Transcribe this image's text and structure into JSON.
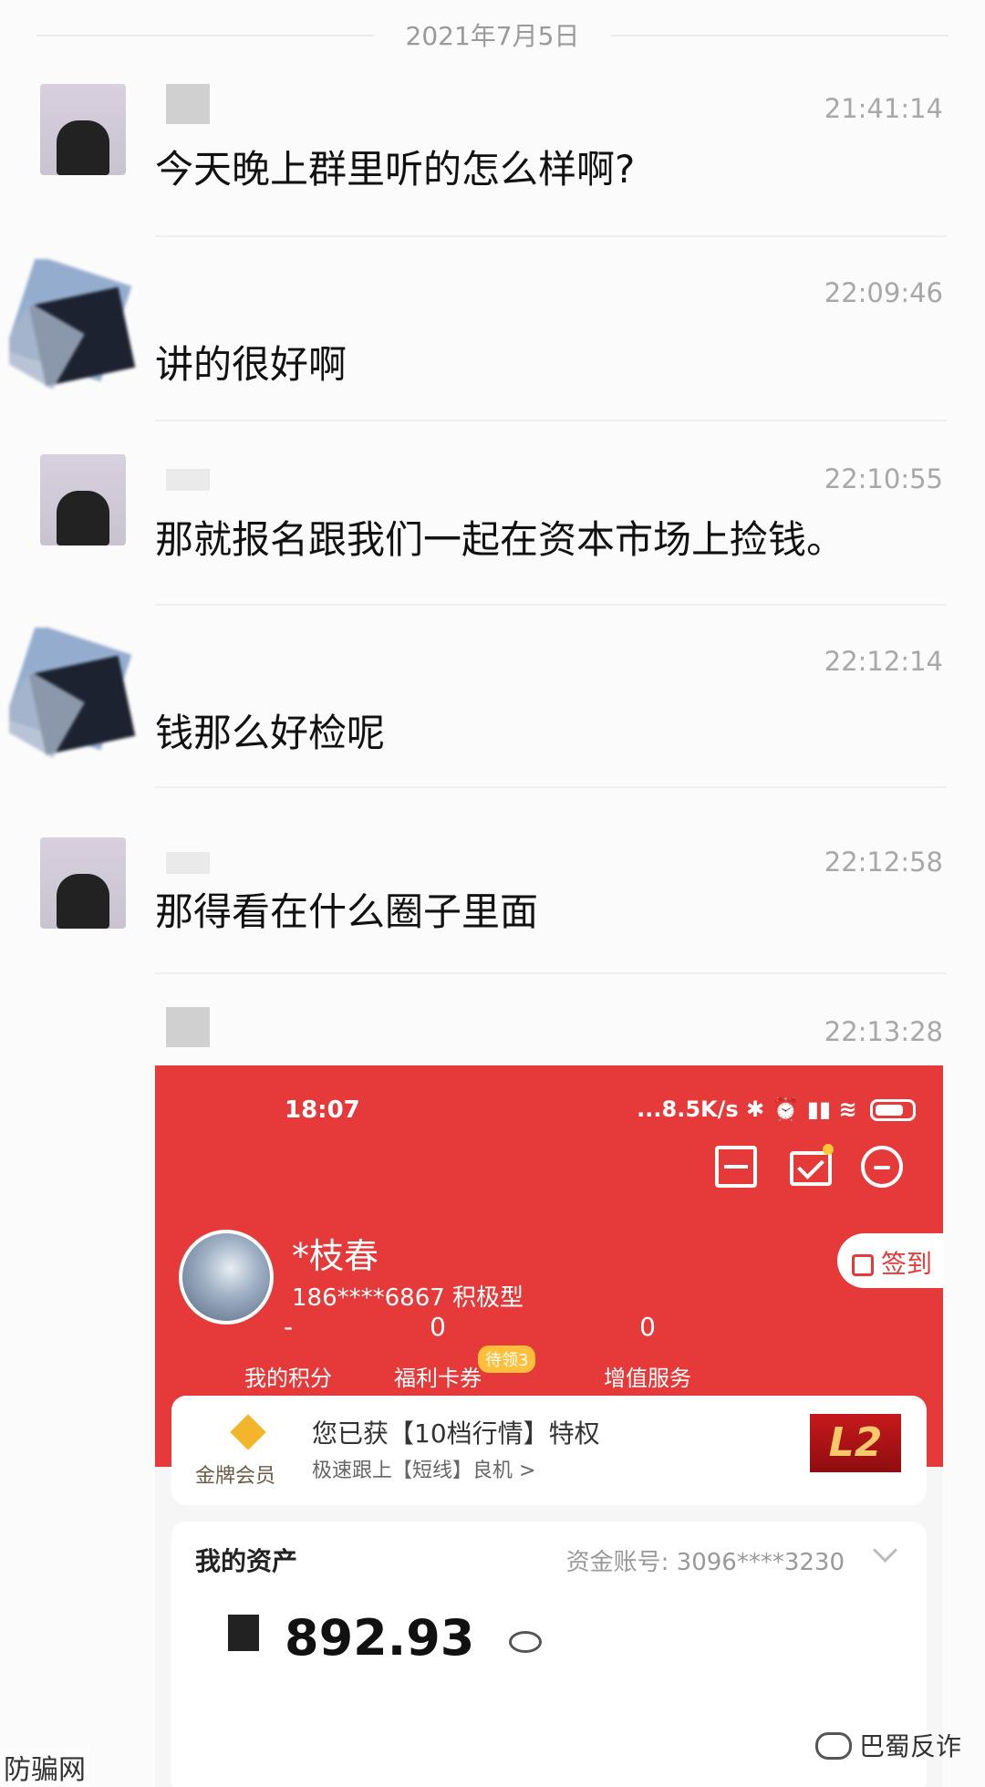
{
  "date_separator": "2021年7月5日",
  "messages": [
    {
      "time": "21:41:14",
      "text": "今天晚上群里听的怎么样啊?"
    },
    {
      "time": "22:09:46",
      "text": "讲的很好啊"
    },
    {
      "time": "22:10:55",
      "text": "那就报名跟我们一起在资本市场上捡钱。"
    },
    {
      "time": "22:12:14",
      "text": "钱那么好检呢"
    },
    {
      "time": "22:12:58",
      "text": "那得看在什么圈子里面"
    },
    {
      "time": "22:13:28",
      "text": ""
    }
  ],
  "screenshot": {
    "status_time": "18:07",
    "status_right": "...8.5K/s",
    "profile_name": "*枝春",
    "profile_info": "186****6867 积极型",
    "checkin": "签到",
    "stats": [
      {
        "value": "-",
        "label": "我的积分"
      },
      {
        "value": "0",
        "label": "福利卡券"
      },
      {
        "value": "0",
        "label": "增值服务"
      }
    ],
    "stat_badge": "待领3",
    "vip_label": "金牌会员",
    "vip_title": "您已获【10档行情】特权",
    "vip_sub": "极速跟上【短线】良机 >",
    "vip_badge": "L2",
    "assets_title": "我的资产",
    "assets_account": "资金账号: 3096****3230",
    "assets_amount": "892.93"
  },
  "watermark_left": "防骗网",
  "watermark_right": "巴蜀反诈"
}
